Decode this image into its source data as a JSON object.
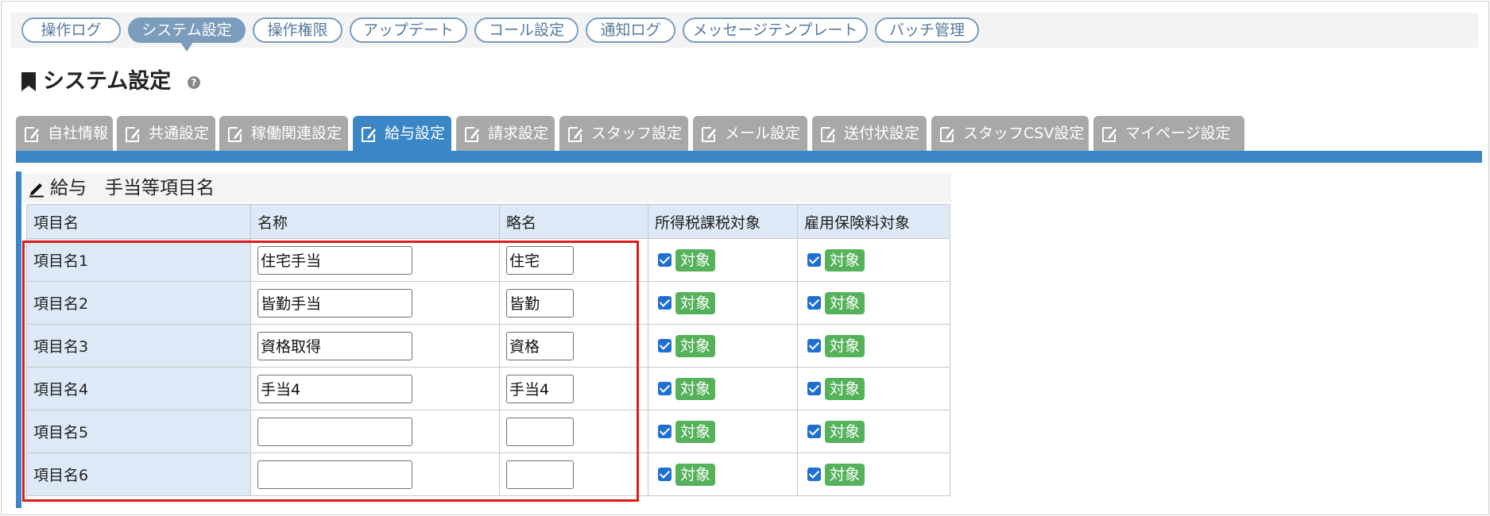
{
  "top_nav": {
    "items": [
      "操作ログ",
      "システム設定",
      "操作権限",
      "アップデート",
      "コール設定",
      "通知ログ",
      "メッセージテンプレート",
      "バッチ管理"
    ],
    "active": "システム設定"
  },
  "page": {
    "title": "システム設定",
    "help_icon": "question-circle-icon"
  },
  "settings_tabs": {
    "items": [
      "自社情報",
      "共通設定",
      "稼働関連設定",
      "給与設定",
      "請求設定",
      "スタッフ設定",
      "メール設定",
      "送付状設定",
      "スタッフCSV設定",
      "マイページ設定"
    ],
    "active": "給与設定",
    "icon": "edit-document-icon"
  },
  "section": {
    "title": "給与　手当等項目名",
    "icon": "pencil-icon",
    "columns": [
      "項目名",
      "名称",
      "略名",
      "所得税課税対象",
      "雇用保険料対象"
    ],
    "rows": [
      {
        "label": "項目名1",
        "name": "住宅手当",
        "short": "住宅",
        "tax": "対象",
        "insurance": "対象"
      },
      {
        "label": "項目名2",
        "name": "皆勤手当",
        "short": "皆勤",
        "tax": "対象",
        "insurance": "対象"
      },
      {
        "label": "項目名3",
        "name": "資格取得",
        "short": "資格",
        "tax": "対象",
        "insurance": "対象"
      },
      {
        "label": "項目名4",
        "name": "手当4",
        "short": "手当4",
        "tax": "対象",
        "insurance": "対象"
      },
      {
        "label": "項目名5",
        "name": "",
        "short": "",
        "tax": "対象",
        "insurance": "対象"
      },
      {
        "label": "項目名6",
        "name": "",
        "short": "",
        "tax": "対象",
        "insurance": "対象"
      }
    ]
  },
  "colors": {
    "nav_accent": "#7b9cbb",
    "tab_active": "#3a86c6",
    "tab_inactive": "#a8a8a8",
    "badge": "#55b25a",
    "highlight": "#e01a1a",
    "header_bg": "#dde9f6"
  }
}
